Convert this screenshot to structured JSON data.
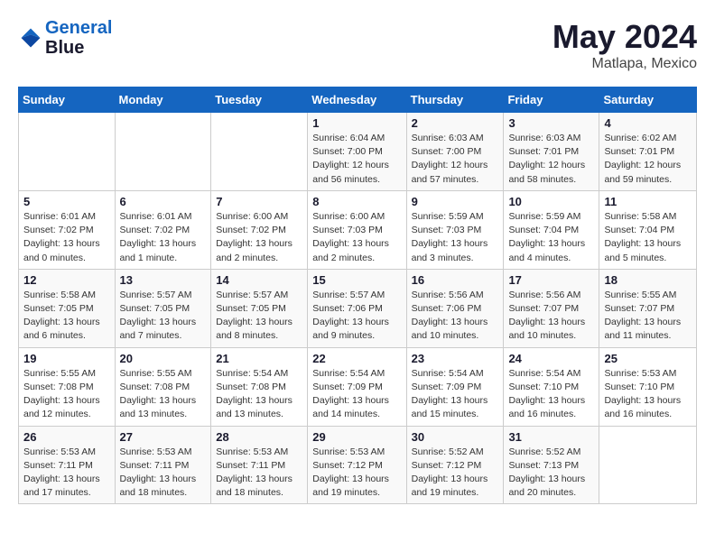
{
  "logo": {
    "text_general": "General",
    "text_blue": "Blue"
  },
  "calendar": {
    "title": "May 2024",
    "subtitle": "Matlapa, Mexico",
    "days_of_week": [
      "Sunday",
      "Monday",
      "Tuesday",
      "Wednesday",
      "Thursday",
      "Friday",
      "Saturday"
    ],
    "weeks": [
      [
        {
          "day": "",
          "info": ""
        },
        {
          "day": "",
          "info": ""
        },
        {
          "day": "",
          "info": ""
        },
        {
          "day": "1",
          "info": "Sunrise: 6:04 AM\nSunset: 7:00 PM\nDaylight: 12 hours\nand 56 minutes."
        },
        {
          "day": "2",
          "info": "Sunrise: 6:03 AM\nSunset: 7:00 PM\nDaylight: 12 hours\nand 57 minutes."
        },
        {
          "day": "3",
          "info": "Sunrise: 6:03 AM\nSunset: 7:01 PM\nDaylight: 12 hours\nand 58 minutes."
        },
        {
          "day": "4",
          "info": "Sunrise: 6:02 AM\nSunset: 7:01 PM\nDaylight: 12 hours\nand 59 minutes."
        }
      ],
      [
        {
          "day": "5",
          "info": "Sunrise: 6:01 AM\nSunset: 7:02 PM\nDaylight: 13 hours\nand 0 minutes."
        },
        {
          "day": "6",
          "info": "Sunrise: 6:01 AM\nSunset: 7:02 PM\nDaylight: 13 hours\nand 1 minute."
        },
        {
          "day": "7",
          "info": "Sunrise: 6:00 AM\nSunset: 7:02 PM\nDaylight: 13 hours\nand 2 minutes."
        },
        {
          "day": "8",
          "info": "Sunrise: 6:00 AM\nSunset: 7:03 PM\nDaylight: 13 hours\nand 2 minutes."
        },
        {
          "day": "9",
          "info": "Sunrise: 5:59 AM\nSunset: 7:03 PM\nDaylight: 13 hours\nand 3 minutes."
        },
        {
          "day": "10",
          "info": "Sunrise: 5:59 AM\nSunset: 7:04 PM\nDaylight: 13 hours\nand 4 minutes."
        },
        {
          "day": "11",
          "info": "Sunrise: 5:58 AM\nSunset: 7:04 PM\nDaylight: 13 hours\nand 5 minutes."
        }
      ],
      [
        {
          "day": "12",
          "info": "Sunrise: 5:58 AM\nSunset: 7:05 PM\nDaylight: 13 hours\nand 6 minutes."
        },
        {
          "day": "13",
          "info": "Sunrise: 5:57 AM\nSunset: 7:05 PM\nDaylight: 13 hours\nand 7 minutes."
        },
        {
          "day": "14",
          "info": "Sunrise: 5:57 AM\nSunset: 7:05 PM\nDaylight: 13 hours\nand 8 minutes."
        },
        {
          "day": "15",
          "info": "Sunrise: 5:57 AM\nSunset: 7:06 PM\nDaylight: 13 hours\nand 9 minutes."
        },
        {
          "day": "16",
          "info": "Sunrise: 5:56 AM\nSunset: 7:06 PM\nDaylight: 13 hours\nand 10 minutes."
        },
        {
          "day": "17",
          "info": "Sunrise: 5:56 AM\nSunset: 7:07 PM\nDaylight: 13 hours\nand 10 minutes."
        },
        {
          "day": "18",
          "info": "Sunrise: 5:55 AM\nSunset: 7:07 PM\nDaylight: 13 hours\nand 11 minutes."
        }
      ],
      [
        {
          "day": "19",
          "info": "Sunrise: 5:55 AM\nSunset: 7:08 PM\nDaylight: 13 hours\nand 12 minutes."
        },
        {
          "day": "20",
          "info": "Sunrise: 5:55 AM\nSunset: 7:08 PM\nDaylight: 13 hours\nand 13 minutes."
        },
        {
          "day": "21",
          "info": "Sunrise: 5:54 AM\nSunset: 7:08 PM\nDaylight: 13 hours\nand 13 minutes."
        },
        {
          "day": "22",
          "info": "Sunrise: 5:54 AM\nSunset: 7:09 PM\nDaylight: 13 hours\nand 14 minutes."
        },
        {
          "day": "23",
          "info": "Sunrise: 5:54 AM\nSunset: 7:09 PM\nDaylight: 13 hours\nand 15 minutes."
        },
        {
          "day": "24",
          "info": "Sunrise: 5:54 AM\nSunset: 7:10 PM\nDaylight: 13 hours\nand 16 minutes."
        },
        {
          "day": "25",
          "info": "Sunrise: 5:53 AM\nSunset: 7:10 PM\nDaylight: 13 hours\nand 16 minutes."
        }
      ],
      [
        {
          "day": "26",
          "info": "Sunrise: 5:53 AM\nSunset: 7:11 PM\nDaylight: 13 hours\nand 17 minutes."
        },
        {
          "day": "27",
          "info": "Sunrise: 5:53 AM\nSunset: 7:11 PM\nDaylight: 13 hours\nand 18 minutes."
        },
        {
          "day": "28",
          "info": "Sunrise: 5:53 AM\nSunset: 7:11 PM\nDaylight: 13 hours\nand 18 minutes."
        },
        {
          "day": "29",
          "info": "Sunrise: 5:53 AM\nSunset: 7:12 PM\nDaylight: 13 hours\nand 19 minutes."
        },
        {
          "day": "30",
          "info": "Sunrise: 5:52 AM\nSunset: 7:12 PM\nDaylight: 13 hours\nand 19 minutes."
        },
        {
          "day": "31",
          "info": "Sunrise: 5:52 AM\nSunset: 7:13 PM\nDaylight: 13 hours\nand 20 minutes."
        },
        {
          "day": "",
          "info": ""
        }
      ]
    ]
  }
}
